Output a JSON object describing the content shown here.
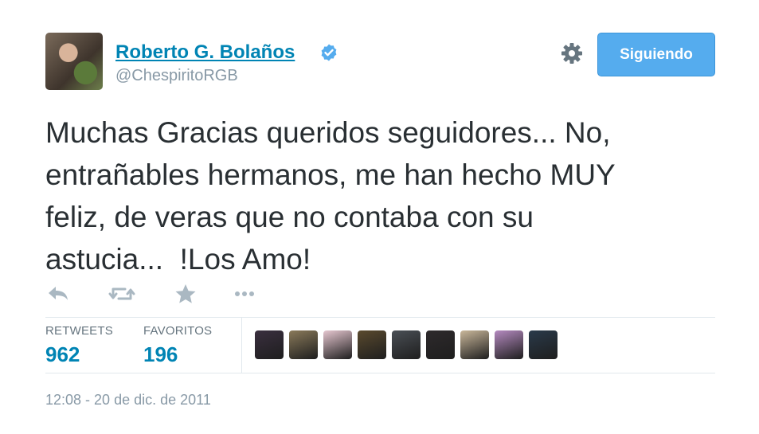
{
  "user": {
    "name": "Roberto G. Bolaños",
    "handle": "@ChespiritoRGB",
    "verified": true,
    "verified_icon": "verified-badge-icon"
  },
  "header": {
    "settings_icon": "gear-icon",
    "follow_button_label": "Siguiendo"
  },
  "tweet": {
    "text": "Muchas Gracias queridos seguidores... No,\nentrañables hermanos, me han hecho MUY\nfeliz, de veras que no contaba con su\nastucia...  !Los Amo!"
  },
  "actions": [
    {
      "icon": "reply-icon"
    },
    {
      "icon": "retweet-icon"
    },
    {
      "icon": "favorite-star-icon"
    },
    {
      "icon": "more-ellipsis-icon"
    }
  ],
  "stats": {
    "retweets_label": "RETWEETS",
    "retweets_count": "962",
    "favorites_label": "FAVORITOS",
    "favorites_count": "196"
  },
  "favoriter_avatars": [
    {
      "color": "#3a2f3f"
    },
    {
      "color": "#8a7a5a"
    },
    {
      "color": "#e6c7d0"
    },
    {
      "color": "#5a4a2e"
    },
    {
      "color": "#4a4f55"
    },
    {
      "color": "#2e2a2c"
    },
    {
      "color": "#c9b79a"
    },
    {
      "color": "#b58ac0"
    },
    {
      "color": "#2a3a4a"
    }
  ],
  "timestamp": "12:08 - 20 de dic. de 2011",
  "colors": {
    "link_blue": "#0084b4",
    "button_blue": "#55acee",
    "muted_gray": "#8899a6",
    "action_gray": "#aab8c2"
  }
}
